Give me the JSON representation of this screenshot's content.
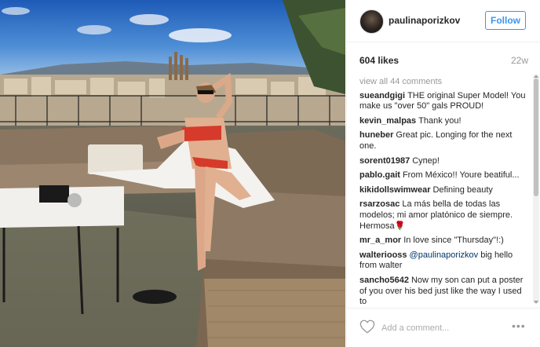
{
  "post": {
    "username": "paulinaporizkov",
    "follow_label": "Follow",
    "likes": "604 likes",
    "age": "22w",
    "view_all": "view all 44 comments",
    "comment_placeholder": "Add a comment...",
    "more_label": "•••"
  },
  "comments": [
    {
      "user": "sueandgigi",
      "text": "THE original Super Model! You make us \"over 50\" gals PROUD!"
    },
    {
      "user": "kevin_malpas",
      "text": "Thank you!"
    },
    {
      "user": "huneber",
      "text": "Great pic. Longing for the next one."
    },
    {
      "user": "sorent01987",
      "text": "Супер!"
    },
    {
      "user": "pablo.gait",
      "text": "From México!! Youre beatiful..."
    },
    {
      "user": "kikidollswimwear",
      "text": "Defining beauty"
    },
    {
      "user": "rsarzosac",
      "text": "La más bella de todas las modelos; mi amor platónico de siempre. Hermosa🌹"
    },
    {
      "user": "mr_a_mor",
      "text": "In love since \"Thursday\"!:)"
    },
    {
      "user": "walteriooss",
      "mention": "@paulinaporizkov",
      "text": "big hello from walter"
    },
    {
      "user": "sancho5642",
      "text": "Now my son can put a poster of you over his bed just like the way I used to"
    }
  ],
  "icons": {
    "heart": "heart-icon",
    "more": "more-options-icon"
  },
  "colors": {
    "accent": "#3897f0",
    "sky": "#3a78c9",
    "sofa": "#8a7560"
  }
}
